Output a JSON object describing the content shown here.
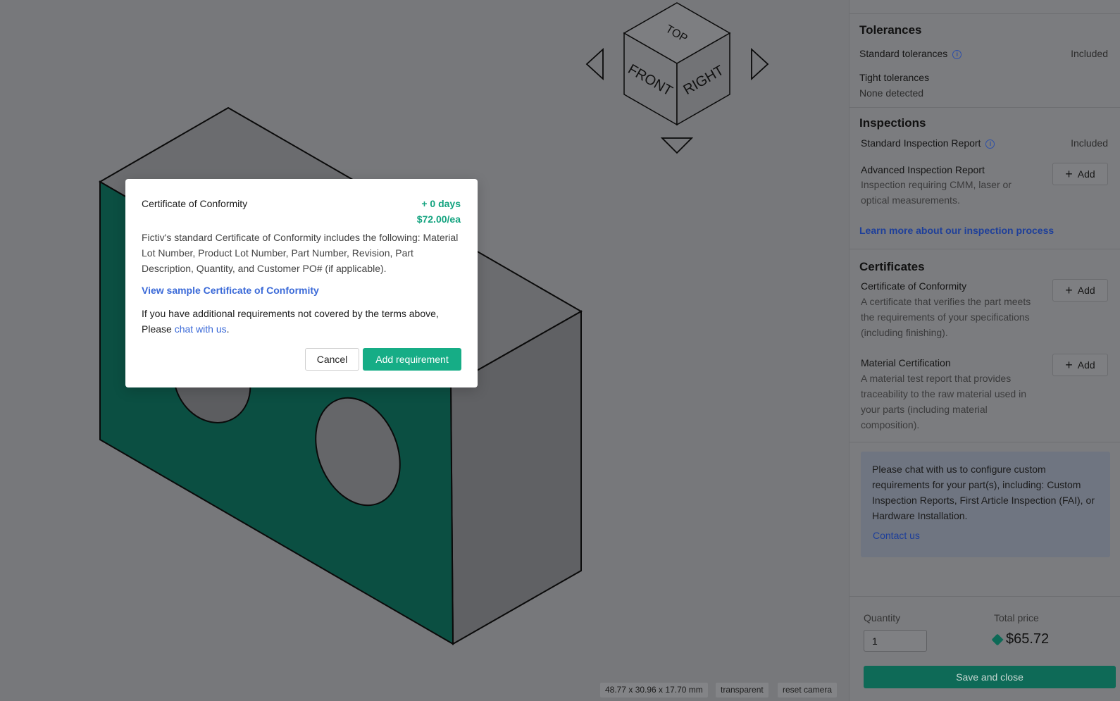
{
  "viewer": {
    "cube_labels": {
      "top": "TOP",
      "front": "FRONT",
      "right": "RIGHT"
    },
    "dimensions": "48.77 x 30.96 x 17.70 mm",
    "transparent_label": "transparent",
    "reset_label": "reset camera",
    "colors": {
      "part_face": "#0b4f42",
      "part_grey": "#6f7073",
      "background": "#77787b"
    }
  },
  "panel": {
    "tolerances": {
      "title": "Tolerances",
      "standard_label": "Standard tolerances",
      "standard_status": "Included",
      "tight_label": "Tight tolerances",
      "tight_value": "None detected"
    },
    "inspections": {
      "title": "Inspections",
      "standard_label": "Standard Inspection Report",
      "standard_status": "Included",
      "advanced_label": "Advanced Inspection Report",
      "advanced_desc_1": "Inspection requiring CMM, laser or",
      "advanced_desc_2": "optical measurements.",
      "add_label": "Add",
      "learn_more": "Learn more about our inspection process"
    },
    "certificates": {
      "title": "Certificates",
      "coc_label": "Certificate of Conformity",
      "coc_desc_1": "A certificate that verifies the part meets",
      "coc_desc_2": "the requirements of your specifications",
      "coc_desc_3": "(including finishing).",
      "mat_label": "Material Certification",
      "mat_desc_1": "A material test report that provides",
      "mat_desc_2": "traceability to the raw material used in",
      "mat_desc_3": "your parts (including material",
      "mat_desc_4": "composition).",
      "add_label": "Add"
    },
    "info_box": {
      "text": "Please chat with us to configure custom requirements for your part(s), including: Custom Inspection Reports, First Article Inspection (FAI), or Hardware Installation.",
      "contact": "Contact us"
    },
    "footer": {
      "quantity_label": "Quantity",
      "quantity_value": "1",
      "total_label": "Total price",
      "total_value": "$65.72",
      "save_label": "Save and close"
    }
  },
  "modal": {
    "title": "Certificate of Conformity",
    "days": "+ 0 days",
    "price": "$72.00/ea",
    "body": "Fictiv's standard Certificate of Conformity includes the following: Material Lot Number, Product Lot Number, Part Number, Revision, Part Description, Quantity, and Customer PO# (if applicable).",
    "sample_link": "View sample Certificate of Conformity",
    "extra_prefix": "If you have additional requirements not covered by the terms above, Please ",
    "extra_link": "chat with us",
    "extra_suffix": ".",
    "cancel_label": "Cancel",
    "add_label": "Add requirement",
    "accent": "#16ad86"
  }
}
